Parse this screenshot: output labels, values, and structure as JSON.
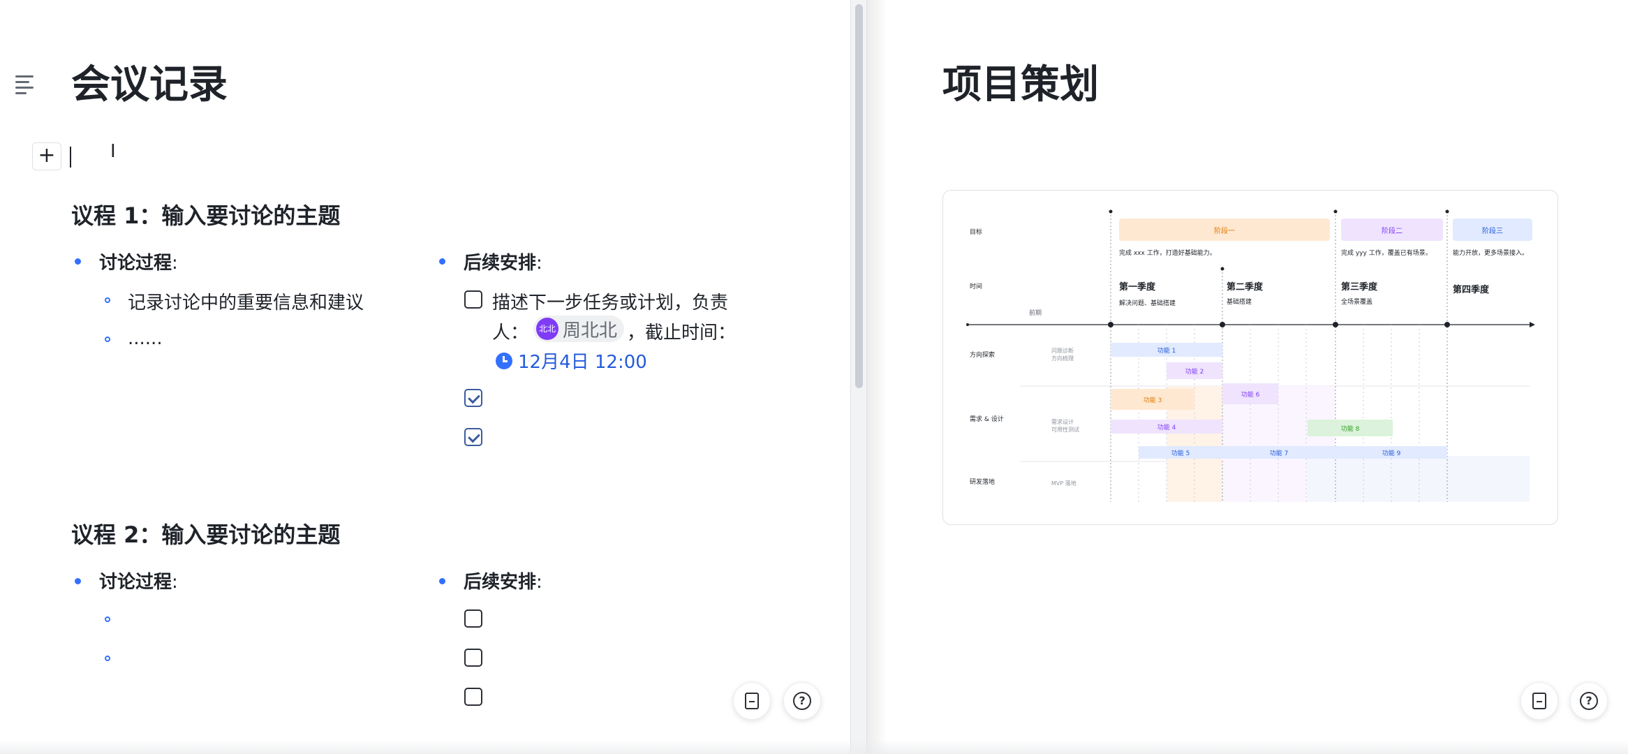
{
  "left": {
    "title": "会议记录",
    "sections": [
      {
        "heading": "议程 1：输入要讨论的主题",
        "discussion_label": "讨论过程",
        "discussion_items": [
          "记录讨论中的重要信息和建议",
          "......"
        ],
        "followup_label": "后续安排",
        "task_text_line1": "描述下一步任务或计划，负责",
        "task_text_line2_prefix": "人：",
        "assignee": "周北北",
        "assignee_avatar": "北北",
        "deadline_label": "，截止时间：",
        "deadline": "12月4日 12:00"
      },
      {
        "heading": "议程 2：输入要讨论的主题",
        "discussion_label": "讨论过程",
        "followup_label": "后续安排"
      }
    ],
    "colon": ":"
  },
  "right": {
    "title": "项目策划"
  },
  "roadmap": {
    "row_labels": [
      "目标",
      "时间",
      "方向探索",
      "需求 & 设计",
      "研发落地"
    ],
    "stages": [
      "阶段一",
      "阶段二",
      "阶段三"
    ],
    "stage_descs": [
      "完成 xxx 工作，打造好基础能力。",
      "完成 yyy 工作，覆盖已有场景。",
      "能力开放，更多场景接入。"
    ],
    "quarters": [
      "第一季度",
      "第二季度",
      "第三季度",
      "第四季度"
    ],
    "quarter_descs": [
      "解决问题、基础搭建",
      "基础搭建",
      "全场景覆盖"
    ],
    "early_label": "前期",
    "sub_labels": [
      "问题诊断",
      "方向梳理",
      "需求设计",
      "可用性测试",
      "MVP 落地"
    ],
    "features": [
      "功能 1",
      "功能 2",
      "功能 3",
      "功能 4",
      "功能 5",
      "功能 6",
      "功能 7",
      "功能 8",
      "功能 9"
    ]
  },
  "colors": {
    "accent": "#3370ff",
    "orange": "#ffe8d1",
    "purple": "#efe3fd",
    "blue": "#e1eaff",
    "green": "#e4f5e4"
  }
}
